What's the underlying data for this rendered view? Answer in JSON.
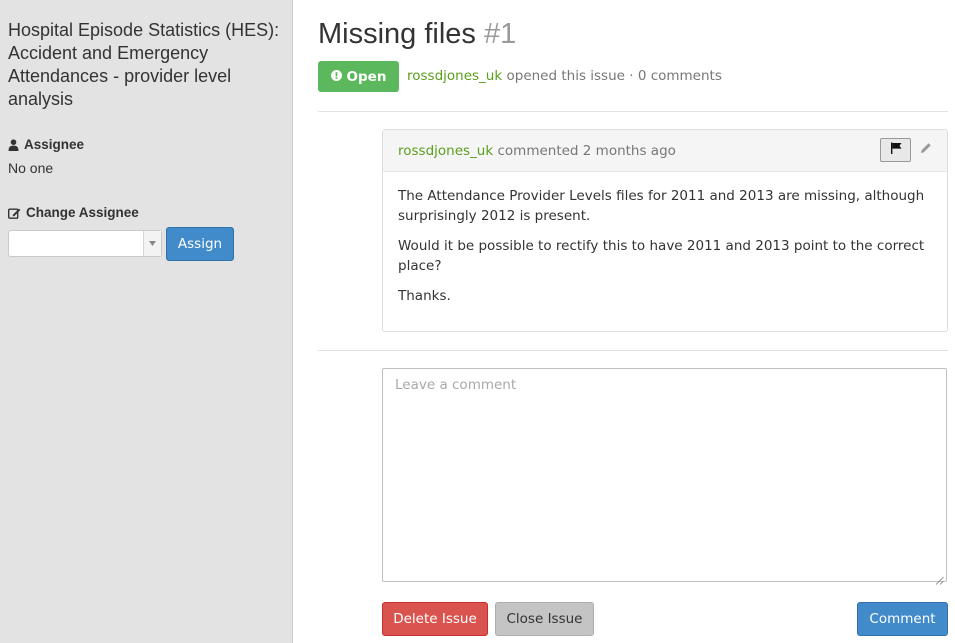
{
  "sidebar": {
    "dataset_title": "Hospital Episode Statistics (HES): Accident and Emergency Attendances - provider level analysis",
    "assignee_heading": "Assignee",
    "assignee_value": "No one",
    "change_assignee_heading": "Change Assignee",
    "select_value": "",
    "assign_label": "Assign"
  },
  "issue": {
    "title": "Missing files",
    "number": "#1",
    "status": "Open",
    "author": "rossdjones_uk",
    "meta_text": "opened this issue · 0 comments"
  },
  "comment": {
    "author": "rossdjones_uk",
    "meta_text": "commented 2 months ago",
    "paragraphs": [
      "The Attendance Provider Levels files for 2011 and 2013 are missing, although surprisingly 2012 is present.",
      "Would it be possible to rectify this to have 2011 and 2013 point to the correct place?",
      "Thanks."
    ]
  },
  "new_comment": {
    "placeholder": "Leave a comment",
    "value": ""
  },
  "actions": {
    "delete_label": "Delete Issue",
    "close_label": "Close Issue",
    "comment_label": "Comment"
  },
  "colors": {
    "sidebar_bg": "#e3e3e3",
    "primary": "#428bca",
    "success": "#5cb85c",
    "danger": "#d9534f",
    "link": "#5a9e1c"
  },
  "icons": {
    "assignee": "user-icon",
    "change_assignee": "edit-icon",
    "status": "exclamation-circle-icon",
    "flag": "flag-icon",
    "edit_comment": "pencil-icon",
    "select": "caret-down-icon"
  }
}
